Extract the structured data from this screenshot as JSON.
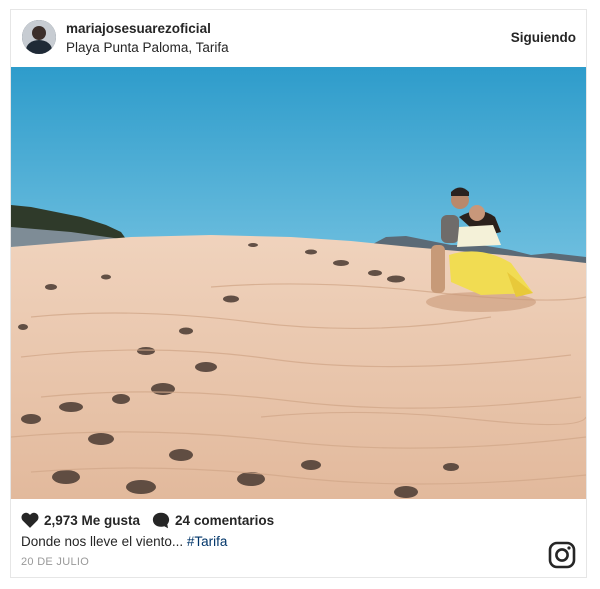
{
  "post": {
    "username": "mariajosesuarezoficial",
    "location": "Playa Punta Paloma, Tarifa",
    "follow_label": "Siguiendo",
    "likes": "2,973 Me gusta",
    "comments": "24 comentarios",
    "caption_text": "Donde nos lleve el viento... ",
    "caption_hashtag": "#Tarifa",
    "date": "20 DE JULIO"
  },
  "icons": {
    "like": "heart-icon",
    "comment": "comment-bubble-icon",
    "brand": "instagram-icon"
  },
  "colors": {
    "sky_top": "#2e9ccb",
    "sky_bottom": "#bfe4f2",
    "sand": "#e9c6ad",
    "hashtag": "#003569",
    "date": "#999999"
  }
}
